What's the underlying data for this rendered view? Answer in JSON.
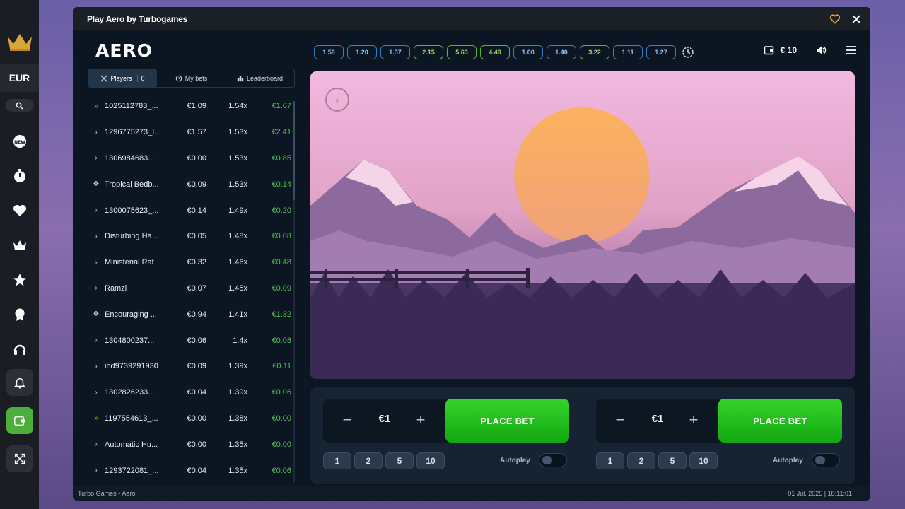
{
  "sidebar": {
    "currency": "EUR",
    "icons": [
      "crown-logo-icon",
      "search-icon",
      "new-badge-icon",
      "stopwatch-icon",
      "heart-icon",
      "crown-icon",
      "star-icon",
      "ribbon-icon",
      "headset-icon",
      "bell-icon",
      "wallet-icon",
      "expand-icon"
    ]
  },
  "window": {
    "title": "Play Aero by Turbogames",
    "icons": [
      "heart-icon",
      "close-icon"
    ]
  },
  "game": {
    "logo": "AERO",
    "tabs": [
      {
        "label": "Players",
        "count": "0"
      },
      {
        "label": "My bets"
      },
      {
        "label": "Leaderboard"
      }
    ],
    "history": [
      {
        "value": "1.59",
        "tone": "blue"
      },
      {
        "value": "1.20",
        "tone": "blue"
      },
      {
        "value": "1.37",
        "tone": "blue"
      },
      {
        "value": "2.15",
        "tone": "green"
      },
      {
        "value": "5.63",
        "tone": "green"
      },
      {
        "value": "4.49",
        "tone": "green"
      },
      {
        "value": "1.00",
        "tone": "blue"
      },
      {
        "value": "1.40",
        "tone": "blue"
      },
      {
        "value": "3.22",
        "tone": "green"
      },
      {
        "value": "1.11",
        "tone": "blue"
      },
      {
        "value": "1.27",
        "tone": "blue"
      }
    ],
    "balance": "€ 10",
    "players": [
      {
        "icon": "double-chevron",
        "name": "1025112783_...",
        "bet": "€1.09",
        "mult": "1.54x",
        "win": "€1.67"
      },
      {
        "icon": "chevron",
        "name": "1296775273_I...",
        "bet": "€1.57",
        "mult": "1.53x",
        "win": "€2.41"
      },
      {
        "icon": "chevron",
        "name": "1306984683...",
        "bet": "€0.00",
        "mult": "1.53x",
        "win": "€0.85"
      },
      {
        "icon": "paw",
        "name": "Tropical Bedb...",
        "bet": "€0.09",
        "mult": "1.53x",
        "win": "€0.14"
      },
      {
        "icon": "chevron",
        "name": "1300075623_...",
        "bet": "€0.14",
        "mult": "1.49x",
        "win": "€0.20"
      },
      {
        "icon": "chevron",
        "name": "Disturbing Ha...",
        "bet": "€0.05",
        "mult": "1.48x",
        "win": "€0.08"
      },
      {
        "icon": "chevron",
        "name": "Ministerial Rat",
        "bet": "€0.32",
        "mult": "1.46x",
        "win": "€0.48"
      },
      {
        "icon": "chevron",
        "name": "Ramzi",
        "bet": "€0.07",
        "mult": "1.45x",
        "win": "€0.09"
      },
      {
        "icon": "paw",
        "name": "Encouraging ...",
        "bet": "€0.94",
        "mult": "1.41x",
        "win": "€1.32"
      },
      {
        "icon": "chevron",
        "name": "1304800237...",
        "bet": "€0.06",
        "mult": "1.4x",
        "win": "€0.08"
      },
      {
        "icon": "chevron",
        "name": "ind9739291930",
        "bet": "€0.09",
        "mult": "1.39x",
        "win": "€0.11"
      },
      {
        "icon": "chevron",
        "name": "1302826233...",
        "bet": "€0.04",
        "mult": "1.39x",
        "win": "€0.06"
      },
      {
        "icon": "double-chevron",
        "name": "1197554613_...",
        "bet": "€0.00",
        "mult": "1.38x",
        "win": "€0.00"
      },
      {
        "icon": "chevron",
        "name": "Automatic Hu...",
        "bet": "€0.00",
        "mult": "1.35x",
        "win": "€0.00"
      },
      {
        "icon": "chevron",
        "name": "1293722081_...",
        "bet": "€0.04",
        "mult": "1.35x",
        "win": "€0.06"
      }
    ],
    "bets": [
      {
        "minus": "−",
        "amount": "€1",
        "plus": "+",
        "place": "PLACE BET",
        "quick": [
          "1",
          "2",
          "5",
          "10"
        ],
        "autoplay": "Autoplay",
        "autoplay_on": false
      },
      {
        "minus": "−",
        "amount": "€1",
        "plus": "+",
        "place": "PLACE BET",
        "quick": [
          "1",
          "2",
          "5",
          "10"
        ],
        "autoplay": "Autoplay",
        "autoplay_on": false
      }
    ]
  },
  "footer": {
    "left": "Turbo Games • Aero",
    "right": "01 Jul, 2025 | 18:11:01"
  }
}
